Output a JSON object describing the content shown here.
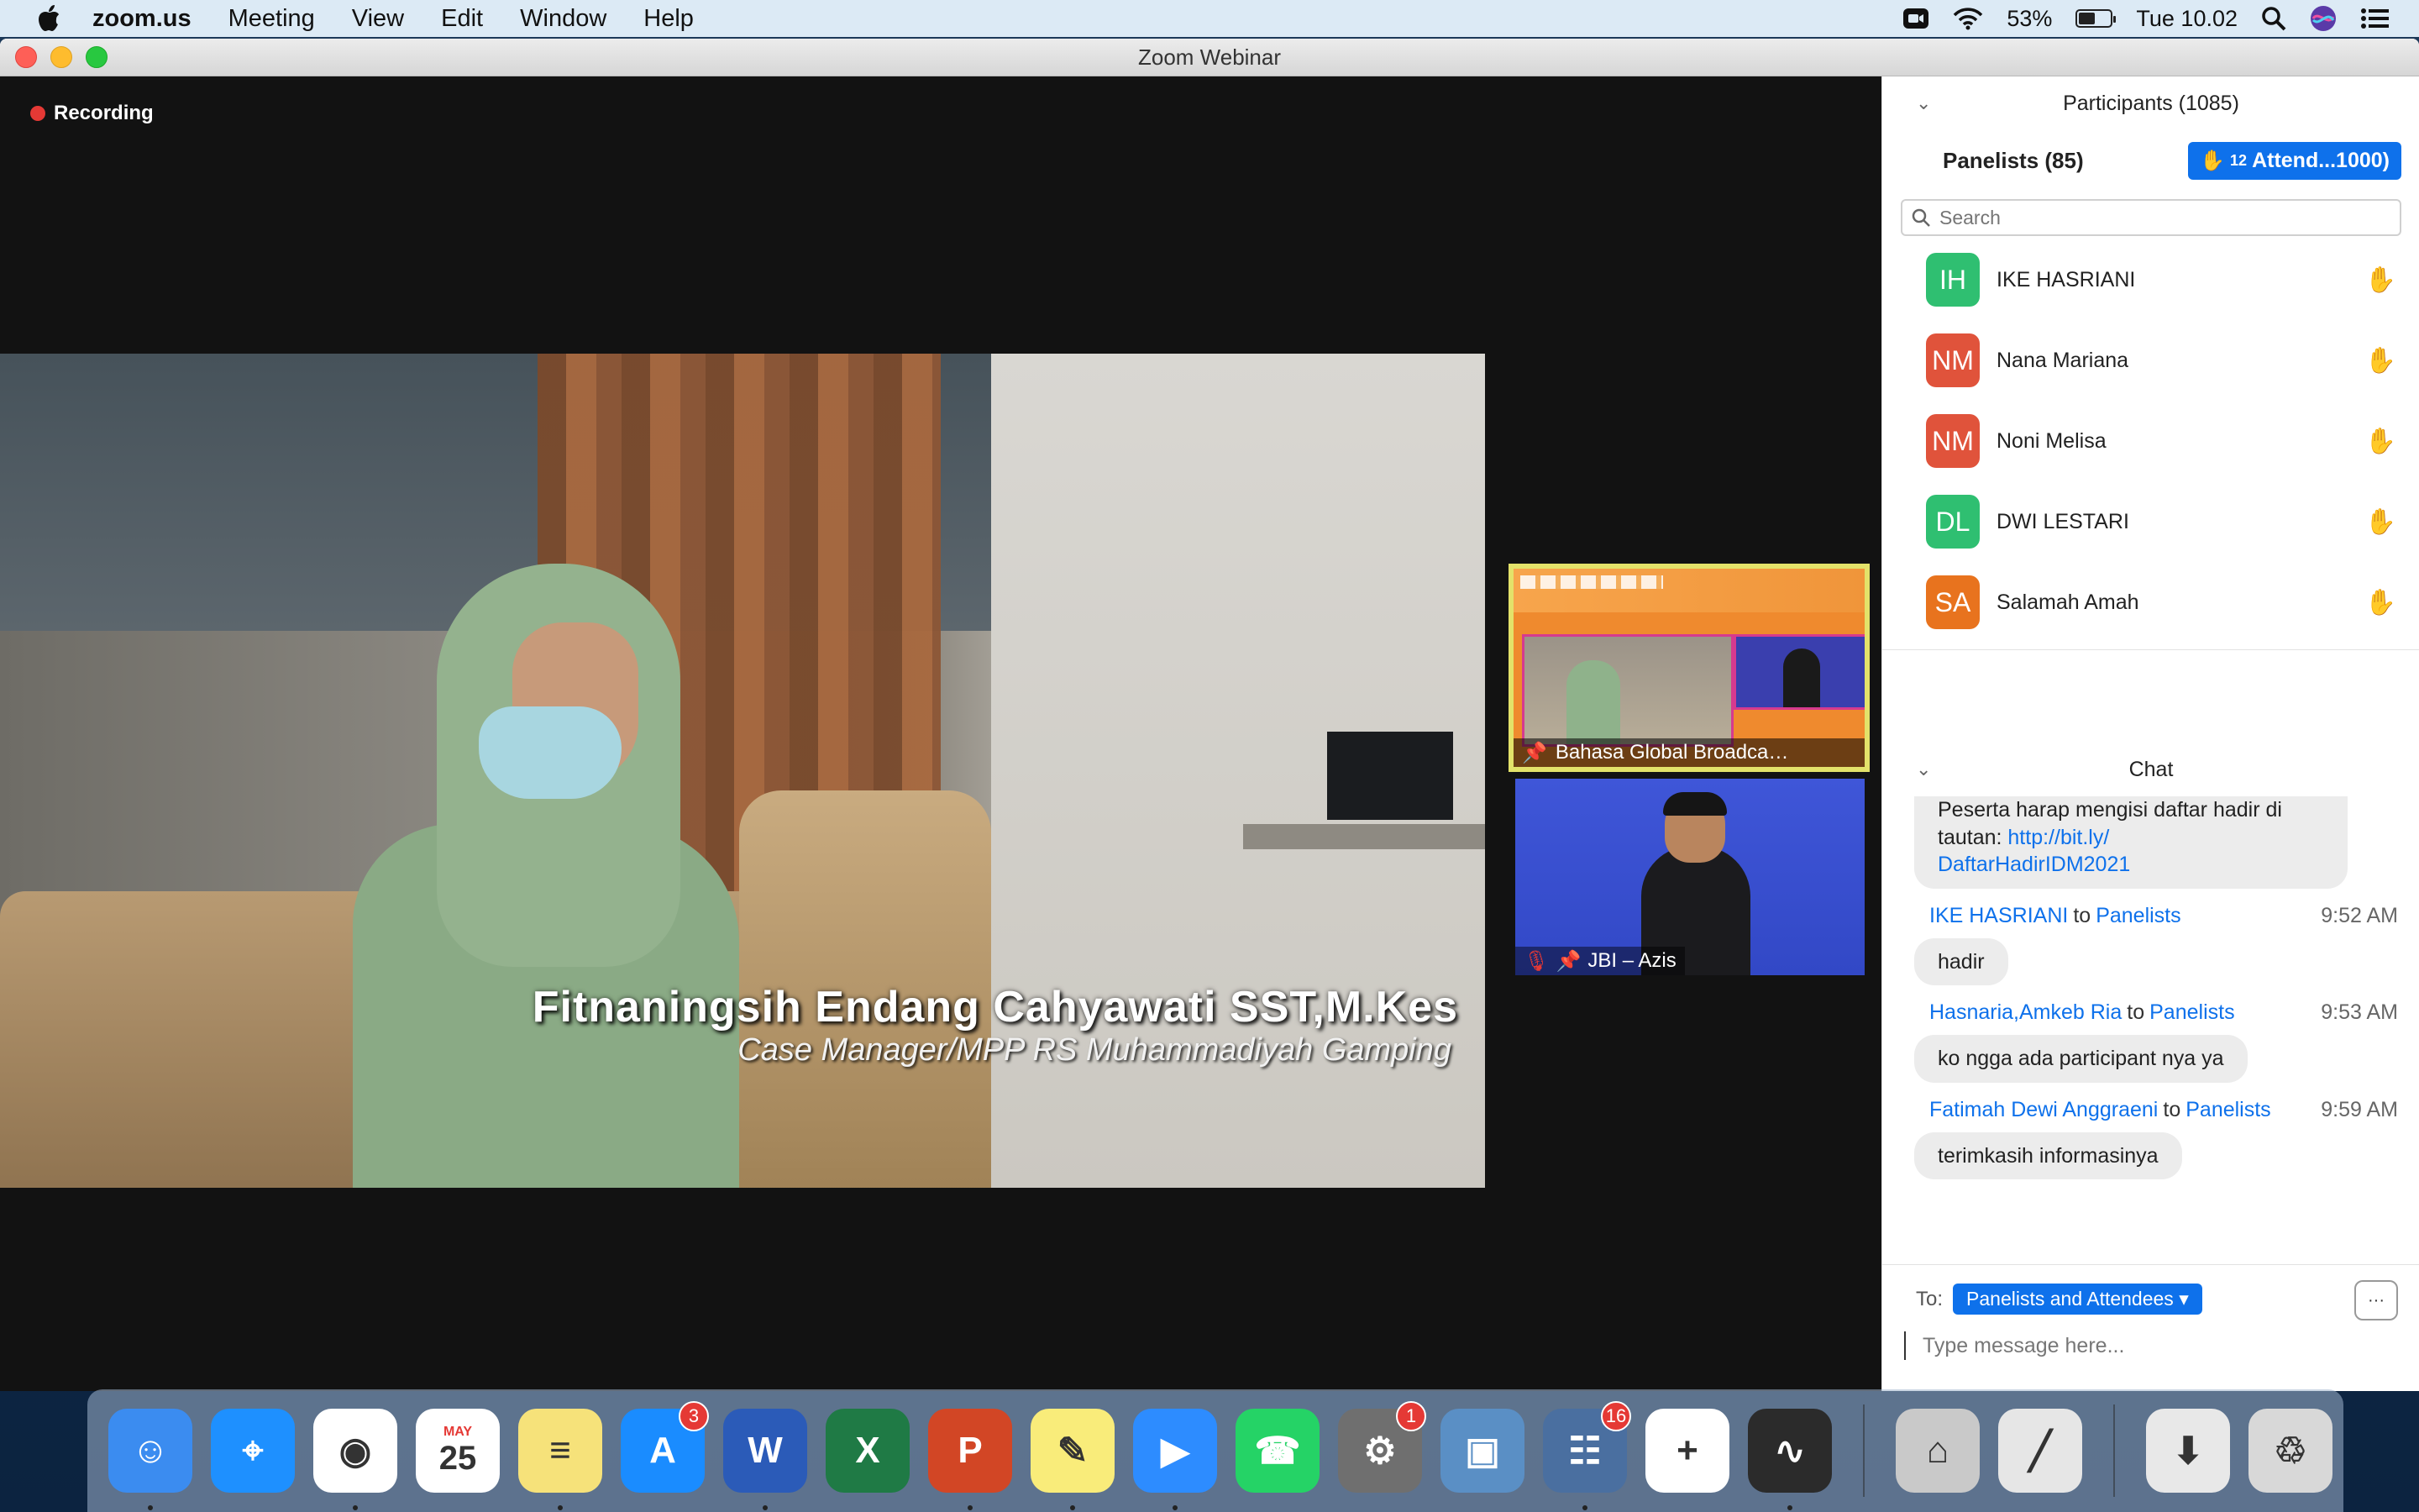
{
  "menubar": {
    "app": "zoom.us",
    "items": [
      "Meeting",
      "View",
      "Edit",
      "Window",
      "Help"
    ],
    "battery_percent": "53%",
    "battery_level": 0.53,
    "clock": "Tue 10.02",
    "icons": [
      "apple-icon",
      "zoom-camera-icon",
      "wifi-icon",
      "battery-icon",
      "spotlight-search-icon",
      "siri-icon",
      "control-center-icon"
    ]
  },
  "window": {
    "title": "Zoom Webinar"
  },
  "video": {
    "recording_label": "Recording",
    "main_speaker_name": "Fitnaningsih Endang Cahyawati SST,M.Kes",
    "main_speaker_role": "Case Manager/MPP RS Muhammadiyah Gamping",
    "thumbnails": [
      {
        "label": "Bahasa Global Broadca…"
      },
      {
        "label": "JBI – Azis"
      }
    ]
  },
  "participants": {
    "header": "Participants (1085)",
    "tab_panelists": "Panelists (85)",
    "tab_attendees": "Attend...1000)",
    "raised_hands_count": "12",
    "search_placeholder": "Search",
    "list": [
      {
        "initials": "IH",
        "name": "IKE HASRIANI",
        "color": "#2fbf71"
      },
      {
        "initials": "NM",
        "name": "Nana Mariana",
        "color": "#e0533b"
      },
      {
        "initials": "NM",
        "name": "Noni Melisa",
        "color": "#e0533b"
      },
      {
        "initials": "DL",
        "name": "DWI LESTARI",
        "color": "#2fbf71"
      },
      {
        "initials": "SA",
        "name": "Salamah Amah",
        "color": "#e8731e"
      }
    ]
  },
  "chat": {
    "header": "Chat",
    "first_message": {
      "text": "Peserta harap mengisi daftar hadir di tautan: ",
      "link": "http://bit.ly/DaftarHadirIDM2021",
      "link_line1": "http://bit.ly/",
      "link_line2": "DaftarHadirIDM2021"
    },
    "messages": [
      {
        "sender": "IKE HASRIANI",
        "to_word": "to",
        "recipient": "Panelists",
        "time": "9:52 AM",
        "text": "hadir"
      },
      {
        "sender": "Hasnaria,Amkeb Ria",
        "to_word": "to",
        "recipient": "Panelists",
        "time": "9:53 AM",
        "text": "ko ngga ada participant nya ya"
      },
      {
        "sender": "Fatimah Dewi Anggraeni",
        "to_word": "to",
        "recipient": "Panelists",
        "time": "9:59 AM",
        "text": "terimkasih informasinya"
      }
    ],
    "to_label": "To:",
    "to_value": "Panelists and Attendees",
    "more_label": "···",
    "input_placeholder": "Type message here..."
  },
  "dock": {
    "apps": [
      {
        "name": "Finder",
        "icon": "finder-icon",
        "color": "#3b8cf0",
        "glyph": "☺",
        "running": true
      },
      {
        "name": "Safari",
        "icon": "safari-icon",
        "color": "#1e90ff",
        "glyph": "⌖",
        "running": false
      },
      {
        "name": "Chrome",
        "icon": "chrome-icon",
        "color": "#ffffff",
        "glyph": "◉",
        "running": true
      },
      {
        "name": "Calendar",
        "icon": "calendar-icon",
        "color": "#ffffff",
        "glyph": "25",
        "month": "MAY",
        "running": false
      },
      {
        "name": "Notes",
        "icon": "notes-icon",
        "color": "#f6e27a",
        "glyph": "≡",
        "running": true
      },
      {
        "name": "App Store",
        "icon": "app-store-icon",
        "color": "#1a8cff",
        "glyph": "A",
        "badge": "3",
        "running": false
      },
      {
        "name": "Word",
        "icon": "word-icon",
        "color": "#2b5bb8",
        "glyph": "W",
        "running": true
      },
      {
        "name": "Excel",
        "icon": "excel-icon",
        "color": "#1f7a45",
        "glyph": "X",
        "running": false
      },
      {
        "name": "PowerPoint",
        "icon": "powerpoint-icon",
        "color": "#d24625",
        "glyph": "P",
        "running": true
      },
      {
        "name": "Stickies",
        "icon": "stickies-icon",
        "color": "#f9ec7a",
        "glyph": "✎",
        "running": true
      },
      {
        "name": "Zoom",
        "icon": "zoom-icon",
        "color": "#2d8cff",
        "glyph": "▶",
        "running": true
      },
      {
        "name": "WhatsApp",
        "icon": "whatsapp-icon",
        "color": "#25d366",
        "glyph": "☎",
        "running": false
      },
      {
        "name": "System Preferences",
        "icon": "system-preferences-icon",
        "color": "#6f6f6f",
        "glyph": "⚙",
        "badge": "1",
        "running": false
      },
      {
        "name": "Preview",
        "icon": "preview-icon",
        "color": "#5a8fc5",
        "glyph": "▣",
        "running": false
      },
      {
        "name": "Launchpad",
        "icon": "launchpad-icon",
        "color": "#4a6fa0",
        "glyph": "☷",
        "badge": "16",
        "running": true
      },
      {
        "name": "Tableau",
        "icon": "tableau-icon",
        "color": "#ffffff",
        "glyph": "+",
        "running": false
      },
      {
        "name": "Audio Recorder",
        "icon": "audio-recorder-icon",
        "color": "#2b2b2b",
        "glyph": "∿",
        "running": true
      }
    ],
    "utilities": [
      {
        "name": "Instruments",
        "icon": "instruments-icon",
        "color": "#c9c9c9",
        "glyph": "⌂"
      },
      {
        "name": "Grapher",
        "icon": "grapher-icon",
        "color": "#e6e6e6",
        "glyph": "╱"
      }
    ],
    "trailing": [
      {
        "name": "Downloads",
        "icon": "downloads-stack-icon",
        "color": "#e8e8e8",
        "glyph": "⬇"
      },
      {
        "name": "Trash",
        "icon": "trash-icon",
        "color": "#d8d8d8",
        "glyph": "♲"
      }
    ]
  }
}
